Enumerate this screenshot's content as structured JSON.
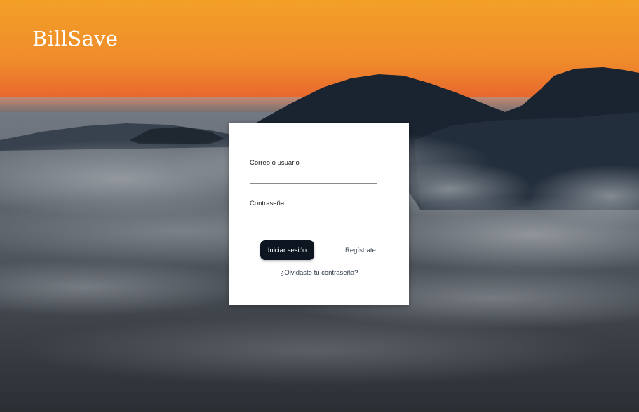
{
  "brand": {
    "name": "BillSave"
  },
  "login": {
    "user_label": "Correo o usuario",
    "user_value": "",
    "password_label": "Contraseña",
    "password_value": "",
    "submit_label": "Iniciar sesión",
    "register_label": "Regístrate",
    "forgot_label": "¿Olvidaste tu contraseña?"
  },
  "colors": {
    "sky_top": "#f5a12a",
    "sky_bottom": "#e9662c",
    "button": "#0d1620",
    "card": "#ffffff"
  }
}
